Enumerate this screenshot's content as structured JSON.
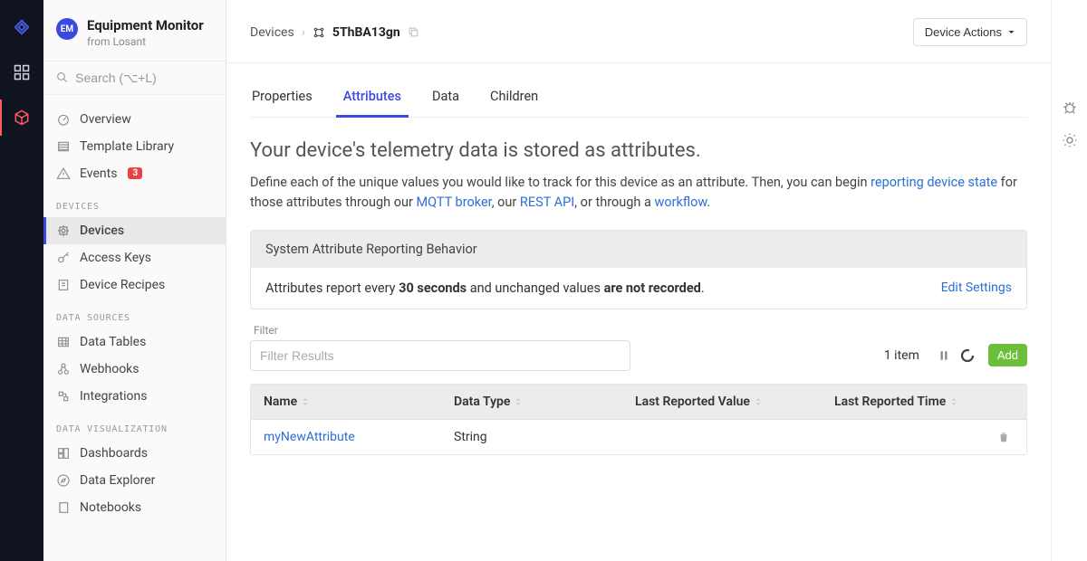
{
  "app": {
    "badge": "EM",
    "title": "Equipment Monitor",
    "subtitle": "from Losant"
  },
  "search": {
    "placeholder": "Search (⌥+L)"
  },
  "nav": {
    "overview": "Overview",
    "template_library": "Template Library",
    "events": "Events",
    "events_badge": "3",
    "heading_devices": "DEVICES",
    "devices": "Devices",
    "access_keys": "Access Keys",
    "device_recipes": "Device Recipes",
    "heading_data_sources": "DATA SOURCES",
    "data_tables": "Data Tables",
    "webhooks": "Webhooks",
    "integrations": "Integrations",
    "heading_data_viz": "DATA VISUALIZATION",
    "dashboards": "Dashboards",
    "data_explorer": "Data Explorer",
    "notebooks": "Notebooks"
  },
  "breadcrumb": {
    "root": "Devices",
    "current": "5ThBA13gn"
  },
  "device_actions_label": "Device Actions",
  "tabs": {
    "properties": "Properties",
    "attributes": "Attributes",
    "data": "Data",
    "children": "Children"
  },
  "page_title": "Your device's telemetry data is stored as attributes.",
  "intro": {
    "pre": "Define each of the unique values you would like to track for this device as an attribute. Then, you can begin ",
    "link1": "reporting device state",
    "mid1": " for those attributes through our ",
    "link2": "MQTT broker",
    "mid2": ", our ",
    "link3": "REST API",
    "mid3": ", or through a ",
    "link4": "workflow",
    "post": "."
  },
  "system_box": {
    "heading": "System Attribute Reporting Behavior",
    "body_pre": "Attributes report every ",
    "body_bold1": "30 seconds",
    "body_mid": " and unchanged values ",
    "body_bold2": "are not recorded",
    "body_post": ".",
    "edit": "Edit Settings"
  },
  "filter": {
    "label": "Filter",
    "placeholder": "Filter Results"
  },
  "count_label": "1 item",
  "add_label": "Add",
  "table": {
    "headers": {
      "name": "Name",
      "type": "Data Type",
      "lrv": "Last Reported Value",
      "lrt": "Last Reported Time"
    },
    "rows": [
      {
        "name": "myNewAttribute",
        "type": "String",
        "lrv": "",
        "lrt": ""
      }
    ]
  }
}
